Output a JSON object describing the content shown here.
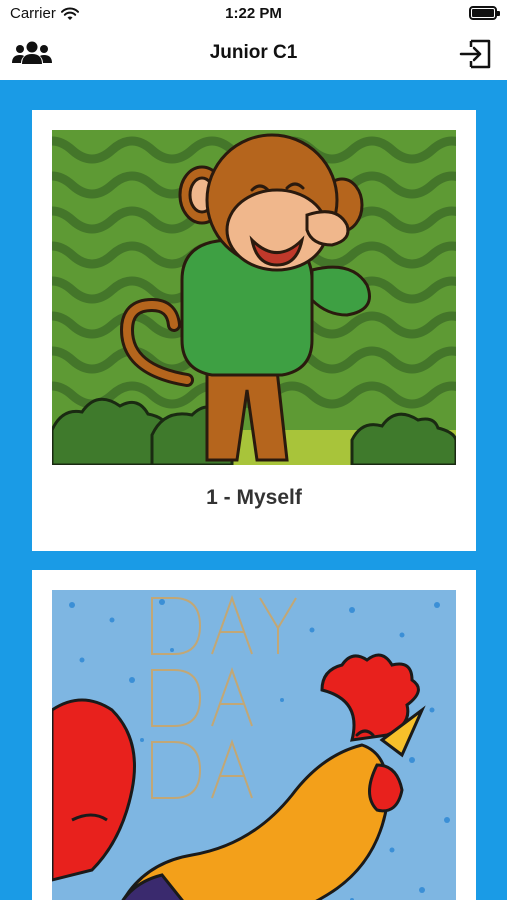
{
  "status_bar": {
    "carrier": "Carrier",
    "time": "1:22 PM"
  },
  "nav": {
    "title": "Junior C1"
  },
  "units": [
    {
      "label": "1 - Myself"
    },
    {
      "label": ""
    }
  ],
  "icons": {
    "wifi": "wifi-icon",
    "battery": "battery-icon",
    "people": "people-icon",
    "logout": "logout-icon"
  },
  "colors": {
    "background": "#1a9be6",
    "card": "#ffffff",
    "header": "#ffffff"
  }
}
